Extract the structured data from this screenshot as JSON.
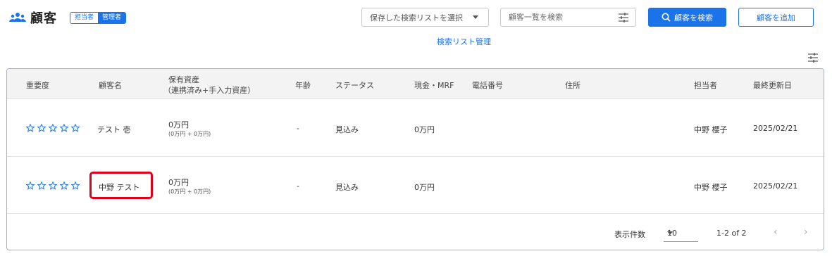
{
  "header": {
    "title": "顧客",
    "role_toggle": [
      "担当者",
      "管理者"
    ],
    "saved_list_select": "保存した検索リストを選択",
    "search": {
      "placeholder": "顧客一覧を検索",
      "value": ""
    },
    "search_button": "顧客を検索",
    "add_button": "顧客を追加",
    "list_management_link": "検索リスト管理"
  },
  "colors": {
    "accent": "#1a73e8",
    "highlight": "#e0001b",
    "header_bg": "#f3f3f3",
    "border": "#8ab6ea"
  },
  "table": {
    "columns": {
      "importance": "重要度",
      "name": "顧客名",
      "assets": "保有資産",
      "assets_sub": "（連携済み+手入力資産）",
      "age": "年齢",
      "status": "ステータス",
      "cash": "現金・MRF",
      "phone": "電話番号",
      "address": "住所",
      "owner": "担当者",
      "updated": "最終更新日"
    },
    "rows": [
      {
        "stars": 0,
        "name": "テスト 壱",
        "assets": "0万円",
        "assets_sub": "(0万円 + 0万円)",
        "age": "-",
        "status": "見込み",
        "cash": "0万円",
        "phone": "",
        "address": "",
        "owner": "中野 櫻子",
        "updated": "2025/02/21"
      },
      {
        "stars": 0,
        "name": "中野 テスト",
        "assets": "0万円",
        "assets_sub": "(0万円 + 0万円)",
        "age": "-",
        "status": "見込み",
        "cash": "0万円",
        "phone": "",
        "address": "",
        "owner": "中野 櫻子",
        "updated": "2025/02/21"
      }
    ]
  },
  "pagination": {
    "per_page_label": "表示件数",
    "per_page": "10",
    "range": "1-2 of 2",
    "prev": "‹",
    "next": "›"
  }
}
